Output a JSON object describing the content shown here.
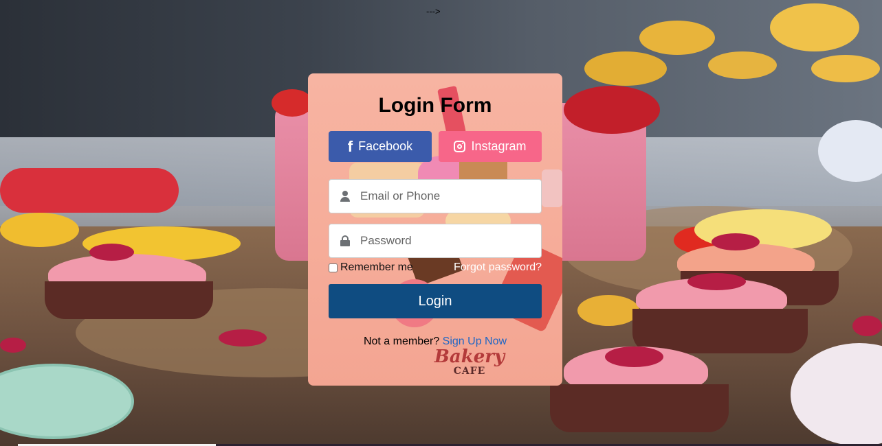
{
  "page": {
    "stray_text": "--->"
  },
  "login_form": {
    "title": "Login Form",
    "facebook_label": "Facebook",
    "instagram_label": "Instagram",
    "email_placeholder": "Email or Phone",
    "email_value": "",
    "password_placeholder": "Password",
    "password_value": "",
    "remember_label": "Remember me",
    "remember_checked": false,
    "forgot_label": "Forgot password?",
    "login_label": "Login",
    "signup_prompt": "Not a member?",
    "signup_link": "Sign Up Now"
  },
  "logo": {
    "main": "Bakery",
    "sub": "CAFE"
  },
  "colors": {
    "card_bg": "#f6ad9a",
    "facebook": "#3b5bab",
    "instagram": "#f76689",
    "login_button": "#0f4c81",
    "link": "#1f66c4"
  },
  "icons": [
    "facebook-icon",
    "instagram-icon",
    "user-icon",
    "lock-icon"
  ]
}
